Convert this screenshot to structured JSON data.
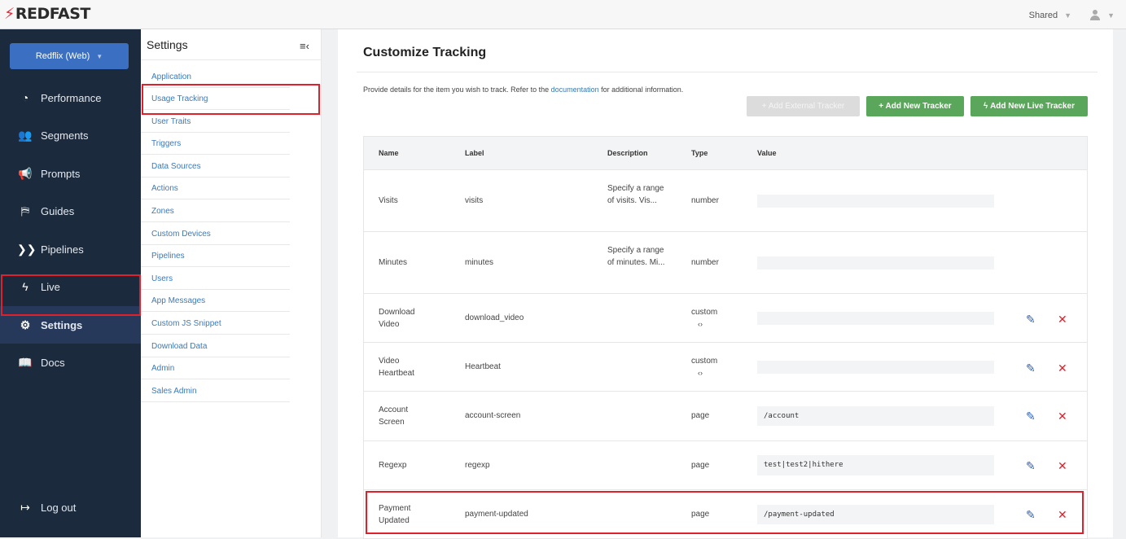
{
  "brand": {
    "logo": "REDFAST",
    "accent": "#e8293a"
  },
  "topbar": {
    "shared_label": "Shared"
  },
  "nav": {
    "workspace": "Redflix (Web)",
    "items": [
      {
        "label": "Performance",
        "icon": "gauge-icon"
      },
      {
        "label": "Segments",
        "icon": "users-icon"
      },
      {
        "label": "Prompts",
        "icon": "megaphone-icon"
      },
      {
        "label": "Guides",
        "icon": "signpost-icon"
      },
      {
        "label": "Pipelines",
        "icon": "pipeline-icon"
      },
      {
        "label": "Live",
        "icon": "bolt-icon"
      },
      {
        "label": "Settings",
        "icon": "gear-icon",
        "active": true
      },
      {
        "label": "Docs",
        "icon": "book-icon"
      }
    ],
    "logout": "Log out"
  },
  "subnav": {
    "title": "Settings",
    "items": [
      "Application",
      "Usage Tracking",
      "User Traits",
      "Triggers",
      "Data Sources",
      "Actions",
      "Zones",
      "Custom Devices",
      "Pipelines",
      "Users",
      "App Messages",
      "Custom JS Snippet",
      "Download Data",
      "Admin",
      "Sales Admin"
    ]
  },
  "main": {
    "title": "Customize Tracking",
    "desc_before": "Provide details for the item you wish to track. Refer to the ",
    "desc_link": "documentation",
    "desc_after": " for additional information.",
    "buttons": {
      "external": "+  Add External Tracker",
      "new": "+  Add New Tracker",
      "live": "Add New Live Tracker"
    }
  },
  "table": {
    "headers": {
      "name": "Name",
      "label": "Label",
      "description": "Description",
      "type": "Type",
      "value": "Value"
    },
    "rows": [
      {
        "name": "Visits",
        "label": "visits",
        "description": "Specify a range of visits. Vis...",
        "type": "number",
        "value": ""
      },
      {
        "name": "Minutes",
        "label": "minutes",
        "description": "Specify a range of minutes. Mi...",
        "type": "number",
        "value": ""
      },
      {
        "name": "Download Video",
        "label": "download_video",
        "description": "",
        "type": "custom",
        "value": ""
      },
      {
        "name": "Video Heartbeat",
        "label": "Heartbeat",
        "description": "",
        "type": "custom",
        "value": ""
      },
      {
        "name": "Account Screen",
        "label": "account-screen",
        "description": "",
        "type": "page",
        "value": "/account"
      },
      {
        "name": "Regexp",
        "label": "regexp",
        "description": "",
        "type": "page",
        "value": "test|test2|hithere"
      },
      {
        "name": "Payment Updated",
        "label": "payment-updated",
        "description": "",
        "type": "page",
        "value": "/payment-updated"
      }
    ]
  }
}
